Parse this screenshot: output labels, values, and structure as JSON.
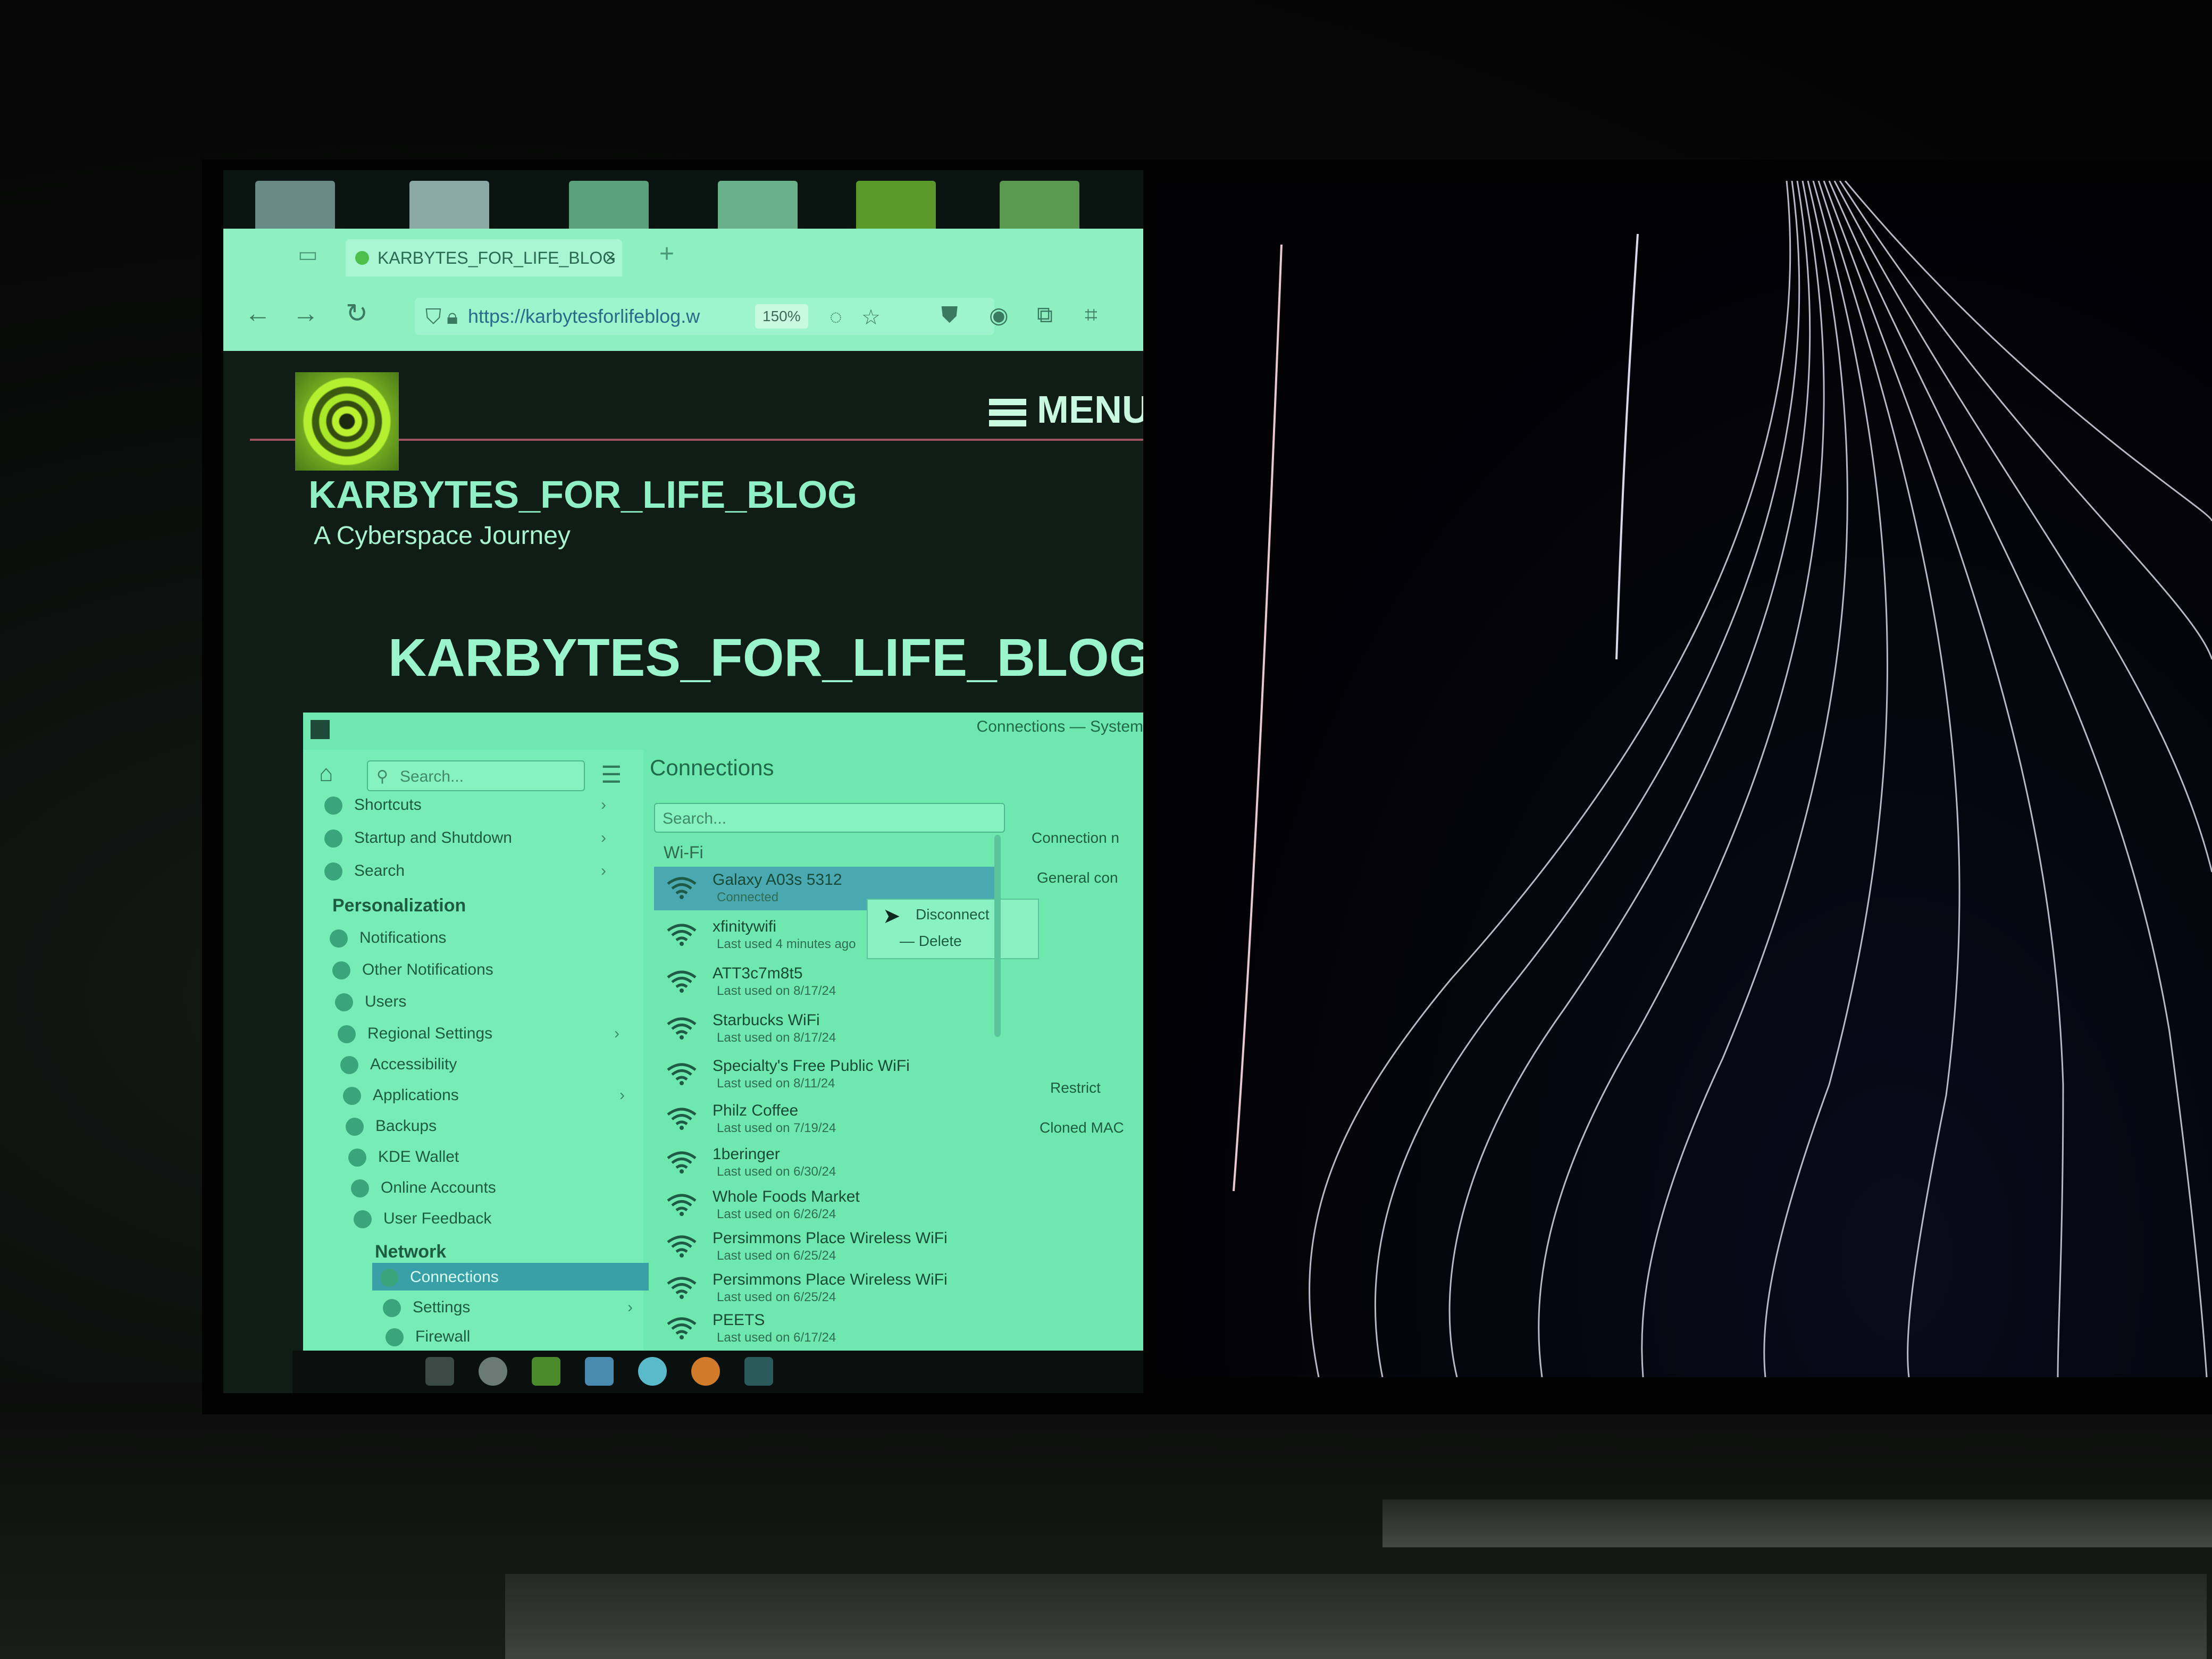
{
  "browser": {
    "tab_title": "KARBYTES_FOR_LIFE_BLOG",
    "tab_close": "×",
    "new_tab": "+",
    "url": "https://karbytesforlifeblog.w",
    "zoom": "150%"
  },
  "site": {
    "menu_label": "MENU",
    "title": "KARBYTES_FOR_LIFE_BLOG",
    "tagline": "A Cyberspace Journey",
    "post_title": "KARBYTES_FOR_LIFE_BLOG"
  },
  "settings": {
    "window_title": "Connections — System",
    "search_placeholder": "Search...",
    "page_title": "Connections",
    "sidebar_items": [
      {
        "label": "Shortcuts",
        "chevron": "›"
      },
      {
        "label": "Startup and Shutdown",
        "chevron": "›"
      },
      {
        "label": "Search",
        "chevron": "›"
      }
    ],
    "personalization_heading": "Personalization",
    "personalization_items": [
      {
        "label": "Notifications",
        "chevron": ""
      },
      {
        "label": "Other Notifications",
        "chevron": ""
      },
      {
        "label": "Users",
        "chevron": ""
      },
      {
        "label": "Regional Settings",
        "chevron": "›"
      },
      {
        "label": "Accessibility",
        "chevron": ""
      },
      {
        "label": "Applications",
        "chevron": "›"
      },
      {
        "label": "Backups",
        "chevron": ""
      },
      {
        "label": "KDE Wallet",
        "chevron": ""
      },
      {
        "label": "Online Accounts",
        "chevron": ""
      },
      {
        "label": "User Feedback",
        "chevron": ""
      }
    ],
    "network_heading": "Network",
    "network_items": [
      {
        "label": "Connections",
        "chevron": ""
      },
      {
        "label": "Settings",
        "chevron": "›"
      },
      {
        "label": "Firewall",
        "chevron": ""
      }
    ],
    "net_search_placeholder": "Search...",
    "wifi_heading": "Wi-Fi",
    "networks": [
      {
        "name": "Galaxy A03s 5312",
        "sub": "Connected"
      },
      {
        "name": "xfinitywifi",
        "sub": "Last used 4 minutes ago"
      },
      {
        "name": "ATT3c7m8t5",
        "sub": "Last used on 8/17/24"
      },
      {
        "name": "Starbucks WiFi",
        "sub": "Last used on 8/17/24"
      },
      {
        "name": "Specialty's Free Public WiFi",
        "sub": "Last used on 8/11/24"
      },
      {
        "name": "Philz Coffee",
        "sub": "Last used on 7/19/24"
      },
      {
        "name": "1beringer",
        "sub": "Last used on 6/30/24"
      },
      {
        "name": "Whole Foods Market",
        "sub": "Last used on 6/26/24"
      },
      {
        "name": "Persimmons Place Wireless WiFi",
        "sub": "Last used on 6/25/24"
      },
      {
        "name": "Persimmons Place Wireless WiFi",
        "sub": "Last used on 6/25/24"
      },
      {
        "name": "PEETS",
        "sub": "Last used on 6/17/24"
      }
    ],
    "context_menu": {
      "disconnect": "Disconnect",
      "delete": "Delete"
    },
    "right_labels": {
      "connection": "Connection n",
      "general": "General con",
      "restrict": "Restrict",
      "cloned": "Cloned MAC"
    }
  },
  "colors": {
    "screen_tint": "#6fe8b0",
    "site_bg": "#0f1d16",
    "title_green": "#8ef0c4"
  }
}
